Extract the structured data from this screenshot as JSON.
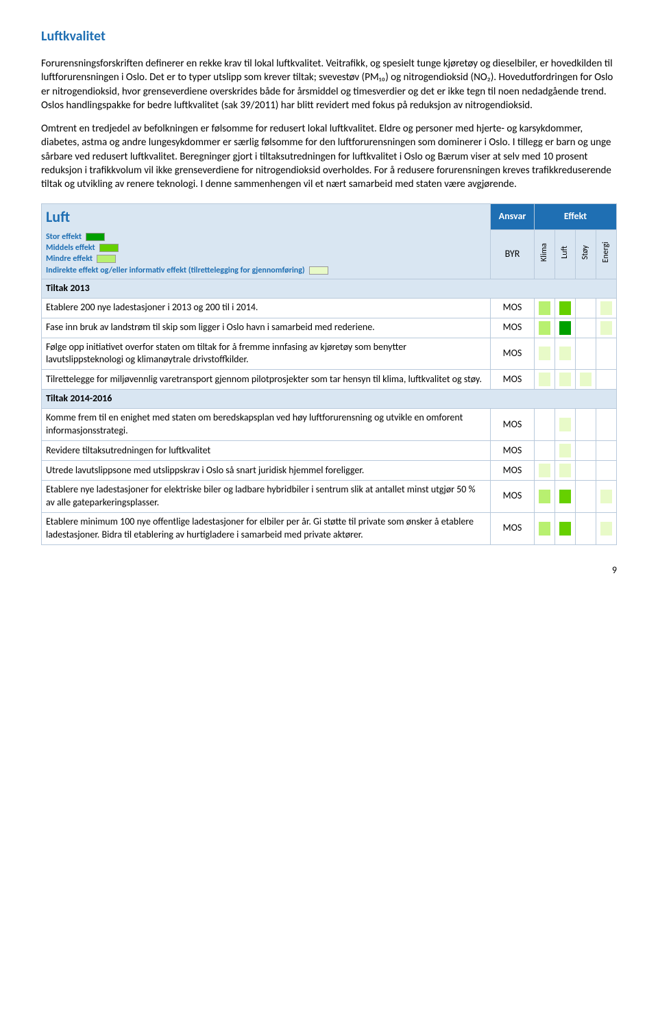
{
  "title": "Luftkvalitet",
  "para1": "Forurensningsforskriften definerer en rekke krav til lokal luftkvalitet. Veitrafikk, og spesielt tunge kjøretøy og dieselbiler, er hovedkilden til luftforurensningen i Oslo. Det er to typer utslipp som krever tiltak; svevestøv (PM₁₀) og nitrogendioksid (NO₂). Hovedutfordringen for Oslo er nitrogendioksid, hvor grenseverdiene overskrides både for årsmiddel og timesverdier og det er ikke tegn til noen nedadgående trend. Oslos handlingspakke for bedre luftkvalitet (sak 39/2011) har blitt revidert med fokus på reduksjon av nitrogendioksid.",
  "para2": "Omtrent en tredjedel av befolkningen er følsomme for redusert lokal luftkvalitet. Eldre og personer med hjerte- og karsykdommer, diabetes, astma og andre lungesykdommer er særlig følsomme for den luftforurensningen som dominerer i Oslo. I tillegg er barn og unge sårbare ved redusert luftkvalitet. Beregninger gjort i tiltaksutredningen for luftkvalitet i Oslo og Bærum viser at selv med 10 prosent reduksjon i trafikkvolum vil ikke grenseverdiene for nitrogendioksid overholdes. For å redusere forurensningen kreves trafikkreduserende tiltak og utvikling av renere teknologi. I denne sammenhengen vil et nært samarbeid med staten være avgjørende.",
  "table": {
    "heading": "Luft",
    "ansvar_hdr": "Ansvar",
    "effekt_hdr": "Effekt",
    "byr": "BYR",
    "cols": [
      "Klima",
      "Luft",
      "Støy",
      "Energi"
    ],
    "legend": {
      "stor": "Stor effekt",
      "middels": "Middels effekt",
      "mindre": "Mindre effekt",
      "indirekte": "Indirekte effekt og/eller informativ effekt (tilrettelegging for gjennomføring)"
    },
    "section_2013": "Tiltak 2013",
    "section_2014": "Tiltak 2014-2016",
    "rows_2013": [
      {
        "desc": "Etablere 200 nye ladestasjoner i 2013 og 200 til i 2014.",
        "ansvar": "MOS",
        "eff": [
          "min",
          "mid",
          "none",
          "ind"
        ]
      },
      {
        "desc": "Fase inn bruk av landstrøm til skip som ligger i Oslo havn i samarbeid med rederiene.",
        "ansvar": "MOS",
        "eff": [
          "min",
          "stor",
          "none",
          "ind"
        ]
      },
      {
        "desc": "Følge opp initiativet overfor staten om tiltak for å fremme innfasing av kjøretøy som benytter lavutslippsteknologi og klimanøytrale drivstoffkilder.",
        "ansvar": "MOS",
        "eff": [
          "ind",
          "ind",
          "none",
          "none"
        ]
      },
      {
        "desc": "Tilrettelegge for miljøvennlig varetransport gjennom pilotprosjekter som tar hensyn til klima, luftkvalitet og støy.",
        "ansvar": "MOS",
        "eff": [
          "ind",
          "ind",
          "ind",
          "none"
        ]
      }
    ],
    "rows_2014": [
      {
        "desc": "Komme frem til en enighet med staten om beredskapsplan ved høy luftforurensning og utvikle en omforent informasjonsstrategi.",
        "ansvar": "MOS",
        "eff": [
          "none",
          "ind",
          "none",
          "none"
        ]
      },
      {
        "desc": "Revidere tiltaksutredningen for luftkvalitet",
        "ansvar": "MOS",
        "eff": [
          "none",
          "ind",
          "none",
          "none"
        ]
      },
      {
        "desc": "Utrede lavutslippsone med utslippskrav i Oslo så snart juridisk hjemmel foreligger.",
        "ansvar": "MOS",
        "eff": [
          "ind",
          "ind",
          "none",
          "none"
        ]
      },
      {
        "desc": "Etablere nye ladestasjoner for elektriske biler og ladbare hybridbiler i sentrum slik at antallet minst utgjør 50 % av alle gateparkeringsplasser.",
        "ansvar": "MOS",
        "eff": [
          "min",
          "mid",
          "none",
          "ind"
        ]
      },
      {
        "desc": "Etablere minimum 100 nye offentlige ladestasjoner for elbiler per år.  Gi støtte til private som ønsker å etablere ladestasjoner. Bidra til etablering av hurtigladere i samarbeid med private aktører.",
        "ansvar": "MOS",
        "eff": [
          "min",
          "mid",
          "none",
          "ind"
        ]
      }
    ]
  },
  "page_number": "9"
}
